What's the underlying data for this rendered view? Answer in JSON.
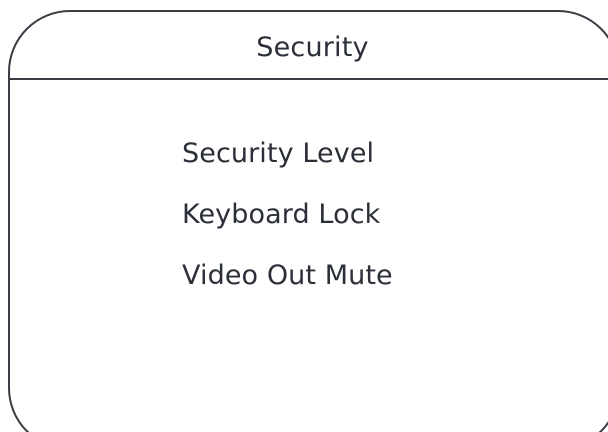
{
  "menu": {
    "title": "Security",
    "items": [
      {
        "label": "Security Level"
      },
      {
        "label": "Keyboard Lock"
      },
      {
        "label": "Video Out Mute"
      }
    ]
  },
  "colors": {
    "border": "#3a3d44",
    "text": "#2b2f38",
    "background": "#ffffff"
  }
}
